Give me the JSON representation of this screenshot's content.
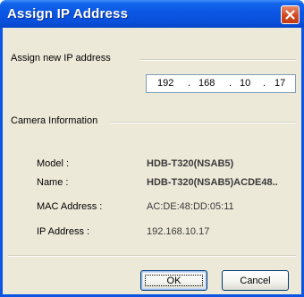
{
  "dialog": {
    "title": "Assign IP Address"
  },
  "assign": {
    "group_label": "Assign new IP address",
    "ip_octets": [
      "192",
      "168",
      "10",
      "17"
    ]
  },
  "camera": {
    "group_label": "Camera Information",
    "model_label": "Model :",
    "model_value": "HDB-T320(NSAB5)",
    "name_label": "Name :",
    "name_value": "HDB-T320(NSAB5)ACDE48..",
    "mac_label": "MAC Address :",
    "mac_value": "AC:DE:48:DD:05:11",
    "ip_label": "IP Address :",
    "ip_value": "192.168.10.17"
  },
  "buttons": {
    "ok_label": "OK",
    "cancel_label": "Cancel"
  },
  "colors": {
    "titlebar": "#0a56e4",
    "close_button": "#d2481f",
    "client_bg": "#ece9d8"
  },
  "icons": {
    "close": "close-icon"
  }
}
